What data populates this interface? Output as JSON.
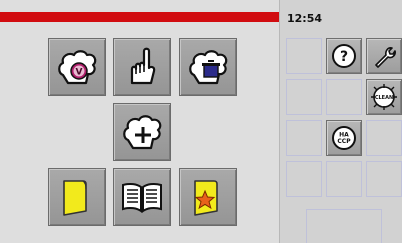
{
  "status": {
    "time": "12:54"
  },
  "colors": {
    "stripe": "#d10c10",
    "folder_yellow": "#f2ea1c",
    "vegetable_circle": "#b01d6b"
  },
  "tiles": [
    {
      "name": "vegetarian-recipes",
      "icon": "chef-hat-v-icon",
      "badge": "V"
    },
    {
      "name": "manual-cooking",
      "icon": "hand-pointing-icon"
    },
    {
      "name": "cooking-program",
      "icon": "chef-hat-pot-icon"
    },
    {
      "name": "add-recipe",
      "icon": "chef-hat-plus-icon"
    },
    {
      "name": "folder",
      "icon": "yellow-folder-icon"
    },
    {
      "name": "recipe-book",
      "icon": "open-book-icon"
    },
    {
      "name": "favorites-folder",
      "icon": "folder-star-icon"
    }
  ],
  "sidebar": {
    "help_label": "?",
    "haccp_label_line1": "HA",
    "haccp_label_line2": "CCP",
    "clean_label": "CLEAN"
  }
}
